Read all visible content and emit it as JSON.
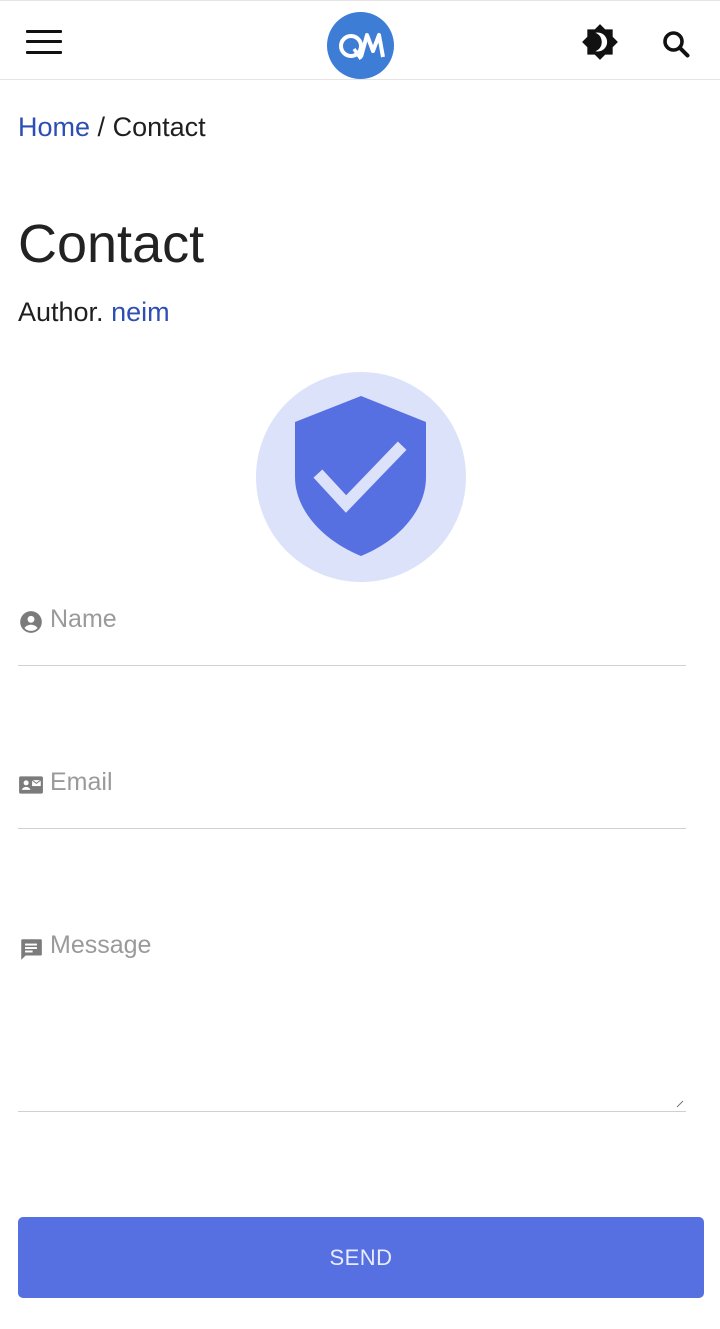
{
  "header": {
    "menu_icon": "hamburger-menu-icon",
    "logo_icon": "site-logo-icon",
    "logo_text": "QM",
    "theme_icon": "brightness-toggle-icon",
    "search_icon": "search-icon"
  },
  "breadcrumb": {
    "home": "Home",
    "separator": "/",
    "current": "Contact"
  },
  "page": {
    "title": "Contact",
    "author_prefix": "Author.",
    "author_name": "neim"
  },
  "hero": {
    "icon": "shield-check-icon"
  },
  "form": {
    "name": {
      "icon": "account-circle-icon",
      "placeholder": "Name",
      "value": ""
    },
    "email": {
      "icon": "contact-mail-icon",
      "placeholder": "Email",
      "value": ""
    },
    "message": {
      "icon": "message-icon",
      "placeholder": "Message",
      "value": ""
    },
    "send_label": "SEND"
  },
  "colors": {
    "accent": "#5670e2",
    "link": "#2d4fb4",
    "logo_bg": "#3d7dd6",
    "hero_bg": "#dde2fb"
  }
}
